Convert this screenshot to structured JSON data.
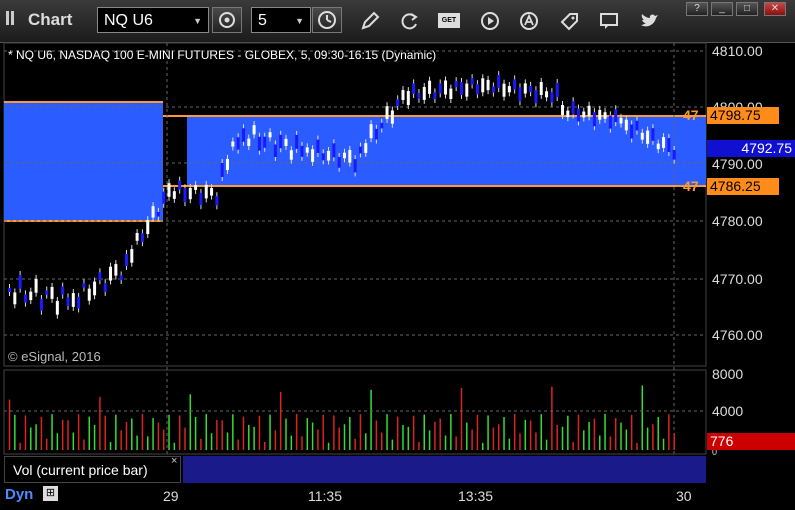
{
  "toolbar": {
    "app_title": "Chart",
    "symbol": "NQ U6",
    "interval": "5",
    "icons": [
      "settings-icon",
      "clock-icon",
      "pencil-icon",
      "refresh-icon",
      "get-icon",
      "play-icon",
      "alert-icon",
      "tag-icon",
      "comment-icon",
      "twitter-icon"
    ],
    "window_buttons": [
      "help",
      "minimize",
      "maximize",
      "close"
    ],
    "get_label": "GET"
  },
  "chart": {
    "title": "* NQ U6, NASDAQ 100 E-MINI FUTURES - GLOBEX, 5, 09:30-16:15 (Dynamic)",
    "copyright": "© eSignal, 2016",
    "price_axis": [
      "4810.00",
      "4800.00",
      "4790.00",
      "4780.00",
      "4770.00",
      "4760.00"
    ],
    "tags": {
      "upper_left": "47",
      "upper_value": "4798.75",
      "current_value": "4792.75",
      "lower_left": "47",
      "lower_value": "4786.25"
    },
    "colors": {
      "band": "#2b5cff",
      "range_line": "#ff9933",
      "current_tag": "#1010d0",
      "volume_tag": "#cc0000",
      "up_bar": "#ffffff",
      "down_bar": "#2020ff"
    }
  },
  "volume": {
    "panel_label": "Vol (current price bar)",
    "close_label": "×",
    "axis": [
      "8000",
      "4000",
      "0"
    ],
    "current_value": "776"
  },
  "time_axis": {
    "mode_label": "Dyn",
    "labels": [
      "29",
      "11:35",
      "13:35",
      "30"
    ]
  }
}
